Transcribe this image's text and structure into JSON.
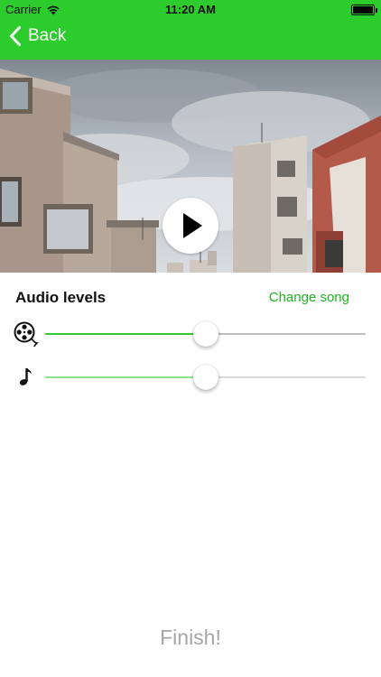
{
  "status": {
    "carrier": "Carrier",
    "time": "11:20 AM",
    "battery_level": 1.0
  },
  "nav": {
    "back_label": "Back"
  },
  "audio": {
    "title": "Audio levels",
    "change_song_label": "Change song",
    "video_level": 0.5,
    "music_level": 0.5
  },
  "footer": {
    "finish_label": "Finish!"
  },
  "colors": {
    "accent": "#2bcc2b",
    "link": "#1fb51f",
    "video_track": "#2bcc2b",
    "music_track": "#8fe38f"
  },
  "icons": [
    "wifi-icon",
    "battery-icon",
    "back-chevron-icon",
    "play-icon",
    "film-reel-icon",
    "music-note-icon"
  ]
}
